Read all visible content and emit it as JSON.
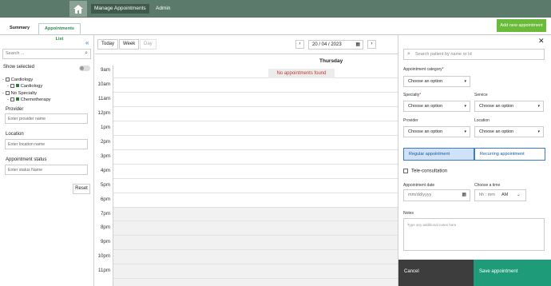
{
  "nav": {
    "items": [
      {
        "label": "Manage Appointments"
      },
      {
        "label": "Admin"
      }
    ]
  },
  "tabs": [
    {
      "label": "Summary"
    },
    {
      "label": "Appointments List"
    }
  ],
  "add_button_label": "Add new appointment",
  "sidebar": {
    "search_placeholder": "Search ...",
    "show_selected_label": "Show selected",
    "tree": [
      {
        "label": "Cardiology",
        "child": "Cardiology"
      },
      {
        "label": "No Specialty",
        "child": "Chemotherapy"
      }
    ],
    "provider": {
      "label": "Provider",
      "placeholder": "Enter provider name"
    },
    "location": {
      "label": "Location",
      "placeholder": "Enter location name"
    },
    "status": {
      "label": "Appointment status",
      "placeholder": "Enter status Name"
    },
    "reset_label": "Reset"
  },
  "calendar": {
    "today_label": "Today",
    "week_label": "Week",
    "day_label": "Day",
    "date_value": "20 / 04 / 2023",
    "day_name": "Thursday",
    "empty_message": "No appointments found",
    "times": [
      "9am",
      "10am",
      "11am",
      "12pm",
      "1pm",
      "2pm",
      "3pm",
      "4pm",
      "5pm",
      "6pm",
      "7pm",
      "8pm",
      "9pm",
      "10pm",
      "11pm"
    ]
  },
  "panel": {
    "search_placeholder": "Search patient by name or Id",
    "category_label": "Appointment category",
    "specialty_label": "Specialty",
    "service_label": "Service",
    "provider_label": "Provider",
    "location_label": "Location",
    "select_placeholder": "Choose an option",
    "regular_label": "Regular appointment",
    "recurring_label": "Recurring appointment",
    "tele_label": "Tele-consultation",
    "date_label": "Appointment date",
    "date_placeholder": "mm/dd/yyyy",
    "time_label": "Choose a time",
    "time_placeholder": "hh : mm",
    "ampm_value": "AM",
    "notes_label": "Notes",
    "notes_placeholder": "Type any additional notes here",
    "cancel_label": "Cancel",
    "save_label": "Save appointment"
  },
  "colors": {
    "topbar": "#5b7a6b",
    "add_button": "#6bbb3b",
    "save_button": "#1e9b78",
    "cancel_button": "#3d3d3d",
    "error_text": "#c0392b"
  },
  "icons": [
    "home-icon",
    "double-chevron-left-icon",
    "search-icon",
    "calendar-icon",
    "close-icon",
    "chevron-down-icon",
    "clock-chevron-icon"
  ]
}
